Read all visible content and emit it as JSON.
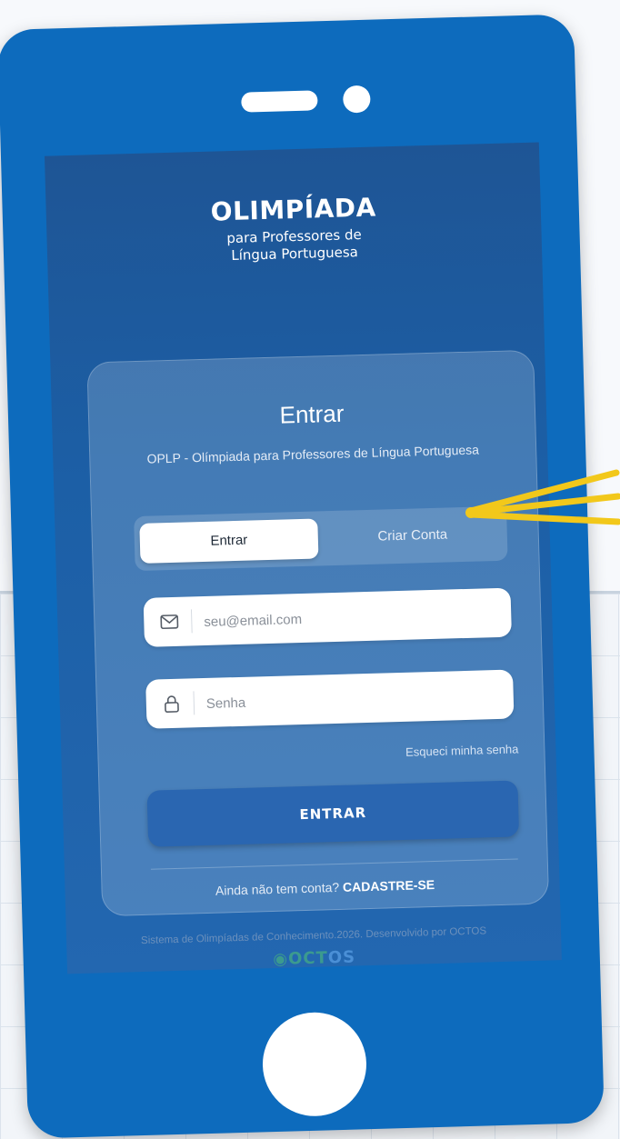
{
  "brand": {
    "title": "OLIMPÍADA",
    "subtitle_line1": "para Professores de",
    "subtitle_line2": "Língua Portuguesa"
  },
  "card": {
    "title": "Entrar",
    "subtitle": "OPLP - Olímpiada para Professores de Língua Portuguesa"
  },
  "tabs": {
    "login_label": "Entrar",
    "signup_label": "Criar Conta"
  },
  "form": {
    "email_placeholder": "seu@email.com",
    "password_placeholder": "Senha",
    "forgot_password": "Esqueci minha senha",
    "submit_label": "ENTRAR"
  },
  "signup": {
    "prompt": "Ainda não tem conta?",
    "link_label": "CADASTRE-SE"
  },
  "footer": {
    "text": "Sistema de Olimpíadas de Conhecimento.2026. Desenvolvido por OCTOS",
    "logo_main": "OCT",
    "logo_tail": "OS"
  },
  "colors": {
    "phone_frame": "#0d6bbd",
    "screen_bg": "#1e5595",
    "submit_button": "#2a66b1",
    "annotation_arrow": "#f2c81b"
  },
  "icons": {
    "email": "mail-icon",
    "password": "lock-icon",
    "footer_logo": "octos-logo-icon"
  }
}
